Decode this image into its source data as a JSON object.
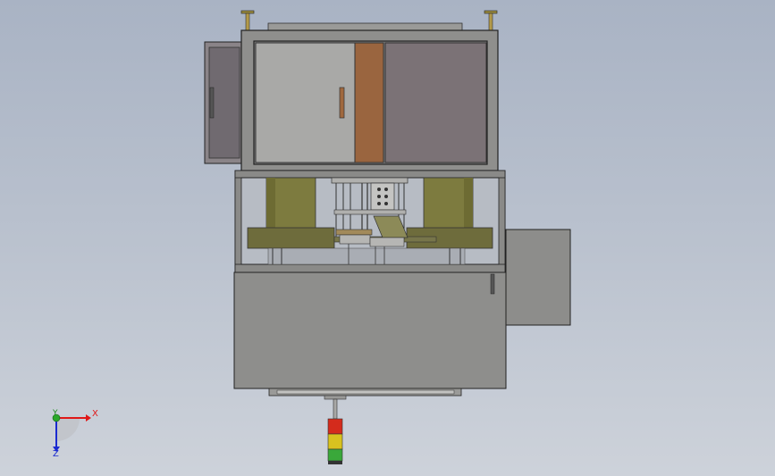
{
  "view": {
    "background_top": "#a9b3c4",
    "background_bottom": "#cdd2da"
  },
  "model": {
    "frame_color": "#8f8f8d",
    "door_left_color": "#a9a9a7",
    "door_wood_color": "#9a653f",
    "door_right_color": "#7b7276",
    "cylinder_color": "#7d7b3f",
    "platform_color": "#6e6c3c",
    "lower_cabinet_color": "#8e8e8c",
    "side_box_color": "#8d8d8b",
    "tower_light": {
      "segments": [
        "red",
        "yellow",
        "green"
      ],
      "colors": [
        "#d42b1c",
        "#d8c21f",
        "#3aa83a"
      ]
    }
  },
  "triad": {
    "x_label": "X",
    "y_label": "Y",
    "z_label": "Z",
    "x_color": "#e01818",
    "y_color": "#1a8a1a",
    "z_color": "#1a2ad0"
  }
}
